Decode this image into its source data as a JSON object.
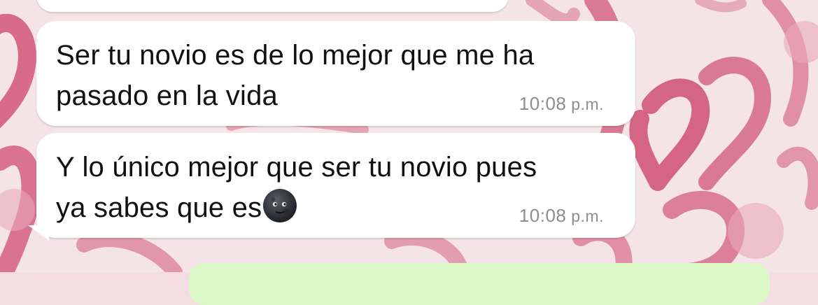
{
  "messages": [
    {
      "text": "Ser tu novio es de lo mejor que me ha\npasado en la vida",
      "time": "10:08",
      "ampm": "p.m."
    },
    {
      "text": "Y lo único mejor que ser tu novio pues\nya sabes que es",
      "emoji": "new-moon-face-icon",
      "time": "10:08",
      "ampm": "p.m."
    }
  ],
  "colors": {
    "incoming_bubble": "#ffffff",
    "outgoing_bubble": "#dcf8c6",
    "timestamp": "#8d8d8d",
    "wallpaper_hearts": "#d45a7a"
  }
}
